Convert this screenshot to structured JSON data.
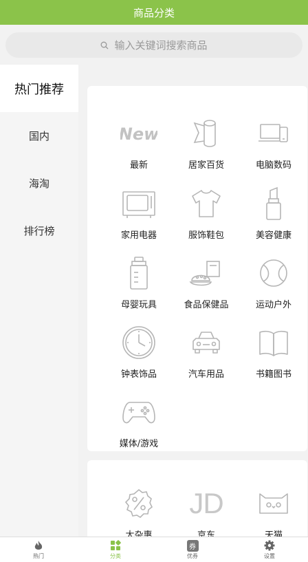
{
  "header": {
    "title": "商品分类"
  },
  "search": {
    "placeholder": "输入关键词搜索商品"
  },
  "sidebar": {
    "items": [
      {
        "label": "热门推荐",
        "active": true
      },
      {
        "label": "国内"
      },
      {
        "label": "海淘"
      },
      {
        "label": "排行榜"
      }
    ]
  },
  "categories": [
    {
      "label": "最新",
      "icon": "new-icon"
    },
    {
      "label": "居家百货",
      "icon": "tissue-roll-icon"
    },
    {
      "label": "电脑数码",
      "icon": "laptop-phone-icon"
    },
    {
      "label": "家用电器",
      "icon": "tv-icon"
    },
    {
      "label": "服饰鞋包",
      "icon": "tshirt-icon"
    },
    {
      "label": "美容健康",
      "icon": "lipstick-icon"
    },
    {
      "label": "母婴玩具",
      "icon": "baby-bottle-icon"
    },
    {
      "label": "食品保健品",
      "icon": "food-icon"
    },
    {
      "label": "运动户外",
      "icon": "ball-icon"
    },
    {
      "label": "钟表饰品",
      "icon": "clock-icon"
    },
    {
      "label": "汽车用品",
      "icon": "car-icon"
    },
    {
      "label": "书籍图书",
      "icon": "book-icon"
    },
    {
      "label": "媒体/游戏",
      "icon": "gamepad-icon"
    }
  ],
  "stores": [
    {
      "label": "大杂惠",
      "icon": "discount-badge-icon"
    },
    {
      "label": "京东",
      "icon": "jd-logo-icon",
      "logo_text": "JD"
    },
    {
      "label": "天猫",
      "icon": "tmall-logo-icon"
    }
  ],
  "tabbar": {
    "items": [
      {
        "label": "热门",
        "icon": "flame-icon"
      },
      {
        "label": "分类",
        "icon": "category-grid-icon",
        "active": true
      },
      {
        "label": "优券",
        "icon": "coupon-icon",
        "badge": "券"
      },
      {
        "label": "设置",
        "icon": "gear-icon"
      }
    ]
  },
  "colors": {
    "accent": "#8bc34a",
    "icon_gray": "#b5b5b5"
  }
}
